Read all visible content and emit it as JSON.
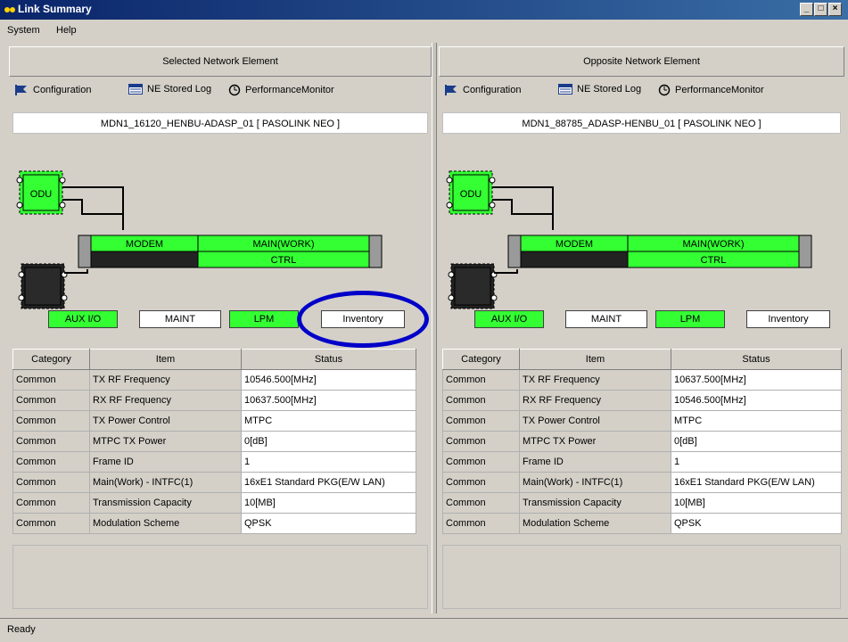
{
  "window": {
    "title": "Link Summary"
  },
  "menu": [
    "System",
    "Help"
  ],
  "status": "Ready",
  "panes": [
    {
      "header": "Selected Network Element",
      "toolbar": {
        "configuration": "Configuration",
        "stored_log": "NE Stored Log",
        "performance": "PerformanceMonitor"
      },
      "ne_name": "MDN1_16120_HENBU-ADASP_01 [ PASOLINK NEO ]",
      "diagram": {
        "odu": "ODU",
        "modem": "MODEM",
        "main": "MAIN(WORK)",
        "ctrl": "CTRL"
      },
      "buttons": {
        "aux": "AUX I/O",
        "maint": "MAINT",
        "lpm": "LPM",
        "inventory": "Inventory"
      },
      "columns": [
        "Category",
        "Item",
        "Status"
      ],
      "rows": [
        [
          "Common",
          "TX RF Frequency",
          "10546.500[MHz]"
        ],
        [
          "Common",
          "RX RF Frequency",
          "10637.500[MHz]"
        ],
        [
          "Common",
          "TX Power Control",
          "MTPC"
        ],
        [
          "Common",
          "MTPC TX Power",
          "0[dB]"
        ],
        [
          "Common",
          "Frame ID",
          "1"
        ],
        [
          "Common",
          "Main(Work) - INTFC(1)",
          "16xE1 Standard PKG(E/W LAN)"
        ],
        [
          "Common",
          "Transmission Capacity",
          "10[MB]"
        ],
        [
          "Common",
          "Modulation Scheme",
          "QPSK"
        ]
      ]
    },
    {
      "header": "Opposite Network Element",
      "toolbar": {
        "configuration": "Configuration",
        "stored_log": "NE Stored Log",
        "performance": "PerformanceMonitor"
      },
      "ne_name": "MDN1_88785_ADASP-HENBU_01 [ PASOLINK NEO ]",
      "diagram": {
        "odu": "ODU",
        "modem": "MODEM",
        "main": "MAIN(WORK)",
        "ctrl": "CTRL"
      },
      "buttons": {
        "aux": "AUX I/O",
        "maint": "MAINT",
        "lpm": "LPM",
        "inventory": "Inventory"
      },
      "columns": [
        "Category",
        "Item",
        "Status"
      ],
      "rows": [
        [
          "Common",
          "TX RF Frequency",
          "10637.500[MHz]"
        ],
        [
          "Common",
          "RX RF Frequency",
          "10546.500[MHz]"
        ],
        [
          "Common",
          "TX Power Control",
          "MTPC"
        ],
        [
          "Common",
          "MTPC TX Power",
          "0[dB]"
        ],
        [
          "Common",
          "Frame ID",
          "1"
        ],
        [
          "Common",
          "Main(Work) - INTFC(1)",
          "16xE1 Standard PKG(E/W LAN)"
        ],
        [
          "Common",
          "Transmission Capacity",
          "10[MB]"
        ],
        [
          "Common",
          "Modulation Scheme",
          "QPSK"
        ]
      ]
    }
  ],
  "colors": {
    "active_green": "#33ff33",
    "highlight_circle": "#0000c8",
    "titlebar": "#0a246a"
  }
}
